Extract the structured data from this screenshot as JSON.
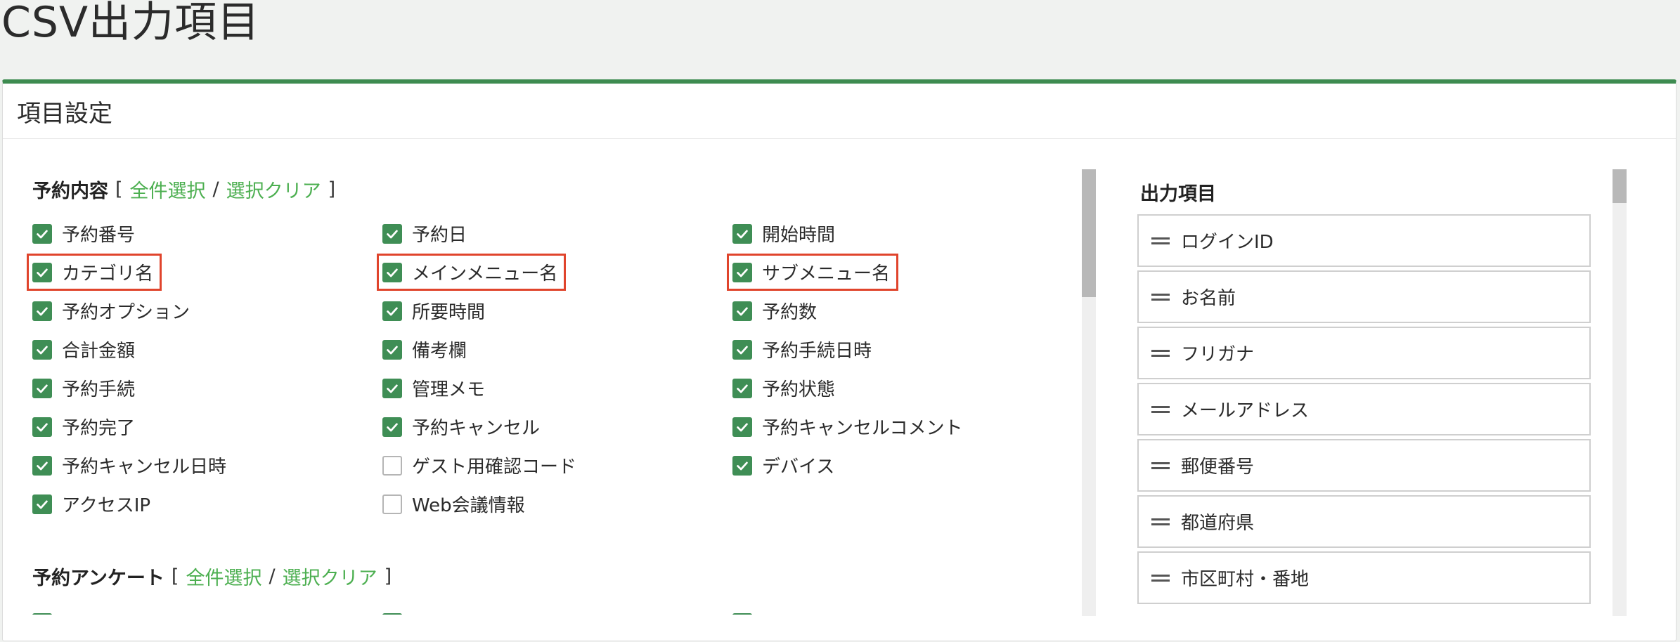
{
  "page": {
    "title": "CSV出力項目"
  },
  "panel": {
    "title": "項目設定"
  },
  "reservation": {
    "title": "予約内容",
    "select_all": "全件選択",
    "clear": "選択クリア",
    "bracket_open": "[",
    "bracket_close": "]",
    "separator": "/",
    "items": [
      {
        "label": "予約番号",
        "checked": true
      },
      {
        "label": "予約日",
        "checked": true
      },
      {
        "label": "開始時間",
        "checked": true
      },
      {
        "label": "カテゴリ名",
        "checked": true,
        "highlighted": true
      },
      {
        "label": "メインメニュー名",
        "checked": true,
        "highlighted": true
      },
      {
        "label": "サブメニュー名",
        "checked": true,
        "highlighted": true
      },
      {
        "label": "予約オプション",
        "checked": true
      },
      {
        "label": "所要時間",
        "checked": true
      },
      {
        "label": "予約数",
        "checked": true
      },
      {
        "label": "合計金額",
        "checked": true
      },
      {
        "label": "備考欄",
        "checked": true
      },
      {
        "label": "予約手続日時",
        "checked": true
      },
      {
        "label": "予約手続",
        "checked": true
      },
      {
        "label": "管理メモ",
        "checked": true
      },
      {
        "label": "予約状態",
        "checked": true
      },
      {
        "label": "予約完了",
        "checked": true
      },
      {
        "label": "予約キャンセル",
        "checked": true
      },
      {
        "label": "予約キャンセルコメント",
        "checked": true
      },
      {
        "label": "予約キャンセル日時",
        "checked": true
      },
      {
        "label": "ゲスト用確認コード",
        "checked": false
      },
      {
        "label": "デバイス",
        "checked": true
      },
      {
        "label": "アクセスIP",
        "checked": true
      },
      {
        "label": "Web会議情報",
        "checked": false
      }
    ]
  },
  "survey": {
    "title": "予約アンケート",
    "select_all": "全件選択",
    "clear": "選択クリア",
    "bracket_open": "[",
    "bracket_close": "]",
    "separator": "/",
    "items": [
      {
        "label": "",
        "checked": true
      },
      {
        "label": "",
        "checked": true
      },
      {
        "label": "",
        "checked": true
      }
    ]
  },
  "output": {
    "title": "出力項目",
    "items": [
      "ログインID",
      "お名前",
      "フリガナ",
      "メールアドレス",
      "郵便番号",
      "都道府県",
      "市区町村・番地"
    ]
  },
  "colors": {
    "accent": "#3d8b50",
    "link": "#4caf50",
    "highlight": "#e0442c"
  }
}
